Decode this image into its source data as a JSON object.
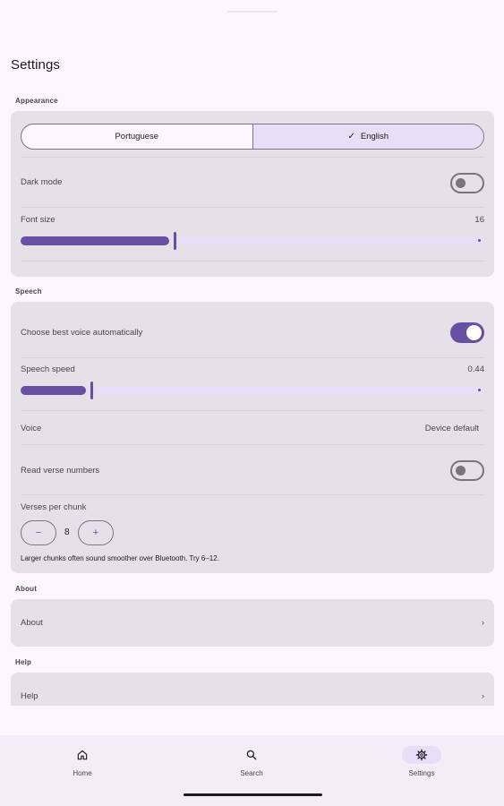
{
  "title": "Settings",
  "appearance": {
    "section_label": "Appearance",
    "language": {
      "options": [
        "Portuguese",
        "English"
      ],
      "selected": "English"
    },
    "dark_mode": {
      "label": "Dark mode",
      "on": false
    },
    "font_size": {
      "label": "Font size",
      "value": "16",
      "fraction": 0.33
    }
  },
  "speech": {
    "section_label": "Speech",
    "auto_voice": {
      "label": "Choose best voice automatically",
      "on": true
    },
    "speed": {
      "label": "Speech speed",
      "value": "0.44",
      "fraction": 0.15
    },
    "voice": {
      "label": "Voice",
      "value": "Device default"
    },
    "verse_numbers": {
      "label": "Read verse numbers",
      "on": false
    },
    "verses_per_chunk": {
      "label": "Verses per chunk",
      "value": "8",
      "minus": "−",
      "plus": "+"
    },
    "hint": "Larger chunks often sound smoother over Bluetooth. Try 6–12."
  },
  "about": {
    "section_label": "About",
    "item_label": "About",
    "chevron": "›"
  },
  "help": {
    "section_label": "Help",
    "item_label": "Help",
    "chevron": "›"
  },
  "bottom_nav": [
    {
      "label": "Home",
      "icon": "home-icon",
      "active": false
    },
    {
      "label": "Search",
      "icon": "search-icon",
      "active": false
    },
    {
      "label": "Settings",
      "icon": "gear-icon",
      "active": true
    }
  ],
  "colors": {
    "accent": "#6750a4",
    "accent_container": "#e8def8",
    "surface": "#fdf7fd",
    "card": "#e6e0e9"
  }
}
